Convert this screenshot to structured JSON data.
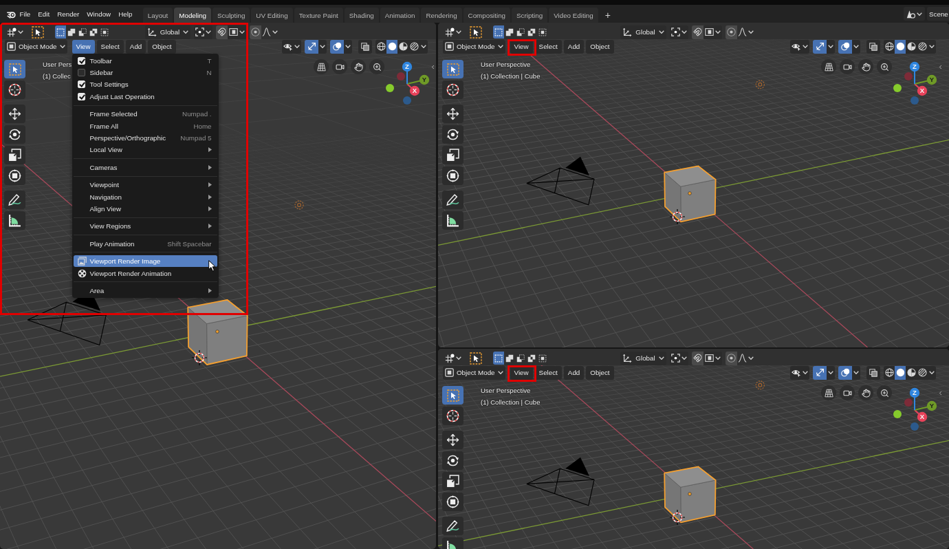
{
  "top_bar": {
    "menus": [
      "File",
      "Edit",
      "Render",
      "Window",
      "Help"
    ],
    "workspaces": [
      {
        "label": "Layout",
        "selected": false
      },
      {
        "label": "Modeling",
        "selected": true
      },
      {
        "label": "Sculpting",
        "selected": false
      },
      {
        "label": "UV Editing",
        "selected": false
      },
      {
        "label": "Texture Paint",
        "selected": false
      },
      {
        "label": "Shading",
        "selected": false
      },
      {
        "label": "Animation",
        "selected": false
      },
      {
        "label": "Rendering",
        "selected": false
      },
      {
        "label": "Compositing",
        "selected": false
      },
      {
        "label": "Scripting",
        "selected": false
      },
      {
        "label": "Video Editing",
        "selected": false
      }
    ],
    "add_workspace": "+",
    "scene": "Scene"
  },
  "viewports": [
    {
      "framed": true,
      "tool_header": {
        "select_modes": [
          {
            "selected": true
          },
          {
            "selected": false
          },
          {
            "selected": false
          },
          {
            "selected": false
          },
          {
            "selected": false
          }
        ],
        "orientation": "Global"
      },
      "header": {
        "mode": "Object Mode",
        "menus": [
          {
            "label": "View",
            "selected": true,
            "framed": false
          },
          {
            "label": "Select",
            "selected": false,
            "framed": false
          },
          {
            "label": "Add",
            "selected": false,
            "framed": false
          },
          {
            "label": "Object",
            "selected": false,
            "framed": false
          }
        ],
        "gizmos_on": true,
        "overlays_on": true,
        "xray_on": false,
        "shading": [
          {
            "selected": false
          },
          {
            "selected": true
          },
          {
            "selected": false
          },
          {
            "selected": false
          }
        ]
      },
      "tool_groups": [
        [
          {
            "kind": "select",
            "selected": true
          },
          {
            "kind": "cursor",
            "selected": false
          }
        ],
        [
          {
            "kind": "move",
            "selected": false
          },
          {
            "kind": "rotate",
            "selected": false
          },
          {
            "kind": "scale",
            "selected": false
          },
          {
            "kind": "transform",
            "selected": false
          }
        ],
        [
          {
            "kind": "annotate",
            "selected": false
          },
          {
            "kind": "measure",
            "selected": false
          }
        ]
      ],
      "info": [
        "User Pers",
        "(1) Collec"
      ],
      "gizmo_axes": [
        "X",
        "Y",
        "Z"
      ],
      "view_menu": {
        "groups": [
          [
            {
              "kind": "check",
              "label": "Toolbar",
              "shortcut": "T",
              "checked": true,
              "selected": false
            },
            {
              "kind": "check",
              "label": "Sidebar",
              "shortcut": "N",
              "checked": false,
              "selected": false
            },
            {
              "kind": "check",
              "label": "Tool Settings",
              "checked": true,
              "selected": false
            },
            {
              "kind": "check",
              "label": "Adjust Last Operation",
              "checked": true,
              "selected": false
            }
          ],
          [
            {
              "kind": "command",
              "label": "Frame Selected",
              "shortcut": "Numpad .",
              "selected": false
            },
            {
              "kind": "command",
              "label": "Frame All",
              "shortcut": "Home",
              "selected": false
            },
            {
              "kind": "command",
              "label": "Perspective/Orthographic",
              "shortcut": "Numpad 5",
              "selected": false
            },
            {
              "kind": "submenu",
              "label": "Local View",
              "selected": false
            }
          ],
          [
            {
              "kind": "submenu",
              "label": "Cameras",
              "selected": false
            }
          ],
          [
            {
              "kind": "submenu",
              "label": "Viewpoint",
              "selected": false
            },
            {
              "kind": "submenu",
              "label": "Navigation",
              "selected": false
            },
            {
              "kind": "submenu",
              "label": "Align View",
              "selected": false
            }
          ],
          [
            {
              "kind": "submenu",
              "label": "View Regions",
              "selected": false
            }
          ],
          [
            {
              "kind": "command",
              "label": "Play Animation",
              "shortcut": "Shift Spacebar",
              "selected": false
            }
          ],
          [
            {
              "kind": "still",
              "label": "Viewport Render Image",
              "selected": true
            },
            {
              "kind": "movie",
              "label": "Viewport Render Animation",
              "selected": false
            }
          ],
          [
            {
              "kind": "submenu",
              "label": "Area",
              "selected": false
            }
          ]
        ]
      }
    },
    {
      "framed": false,
      "tool_header": {
        "select_modes": [
          {
            "selected": true
          },
          {
            "selected": false
          },
          {
            "selected": false
          },
          {
            "selected": false
          },
          {
            "selected": false
          }
        ],
        "orientation": "Global"
      },
      "header": {
        "mode": "Object Mode",
        "menus": [
          {
            "label": "View",
            "selected": false,
            "framed": true
          },
          {
            "label": "Select",
            "selected": false,
            "framed": false
          },
          {
            "label": "Add",
            "selected": false,
            "framed": false
          },
          {
            "label": "Object",
            "selected": false,
            "framed": false
          }
        ],
        "gizmos_on": true,
        "overlays_on": true,
        "xray_on": false,
        "shading": [
          {
            "selected": false
          },
          {
            "selected": true
          },
          {
            "selected": false
          },
          {
            "selected": false
          }
        ]
      },
      "tool_groups": [
        [
          {
            "kind": "select",
            "selected": true
          },
          {
            "kind": "cursor",
            "selected": false
          }
        ],
        [
          {
            "kind": "move",
            "selected": false
          },
          {
            "kind": "rotate",
            "selected": false
          },
          {
            "kind": "scale",
            "selected": false
          },
          {
            "kind": "transform",
            "selected": false
          }
        ],
        [
          {
            "kind": "annotate",
            "selected": false
          },
          {
            "kind": "measure",
            "selected": false
          }
        ]
      ],
      "info": [
        "User Perspective",
        "(1) Collection | Cube"
      ],
      "gizmo_axes": [
        "X",
        "Y",
        "Z"
      ]
    },
    {
      "framed": false,
      "tool_header": {
        "select_modes": [
          {
            "selected": true
          },
          {
            "selected": false
          },
          {
            "selected": false
          },
          {
            "selected": false
          },
          {
            "selected": false
          }
        ],
        "orientation": "Global"
      },
      "header": {
        "mode": "Object Mode",
        "menus": [
          {
            "label": "View",
            "selected": false,
            "framed": true
          },
          {
            "label": "Select",
            "selected": false,
            "framed": false
          },
          {
            "label": "Add",
            "selected": false,
            "framed": false
          },
          {
            "label": "Object",
            "selected": false,
            "framed": false
          }
        ],
        "gizmos_on": true,
        "overlays_on": true,
        "xray_on": false,
        "shading": [
          {
            "selected": false
          },
          {
            "selected": true
          },
          {
            "selected": false
          },
          {
            "selected": false
          }
        ]
      },
      "tool_groups": [
        [
          {
            "kind": "select",
            "selected": true
          },
          {
            "kind": "cursor",
            "selected": false
          }
        ],
        [
          {
            "kind": "move",
            "selected": false
          },
          {
            "kind": "rotate",
            "selected": false
          },
          {
            "kind": "scale",
            "selected": false
          },
          {
            "kind": "transform",
            "selected": false
          }
        ],
        [
          {
            "kind": "annotate",
            "selected": false
          },
          {
            "kind": "measure",
            "selected": false
          }
        ]
      ],
      "info": [
        "User Perspective",
        "(1) Collection | Cube"
      ],
      "gizmo_axes": [
        "X",
        "Y",
        "Z"
      ]
    }
  ]
}
